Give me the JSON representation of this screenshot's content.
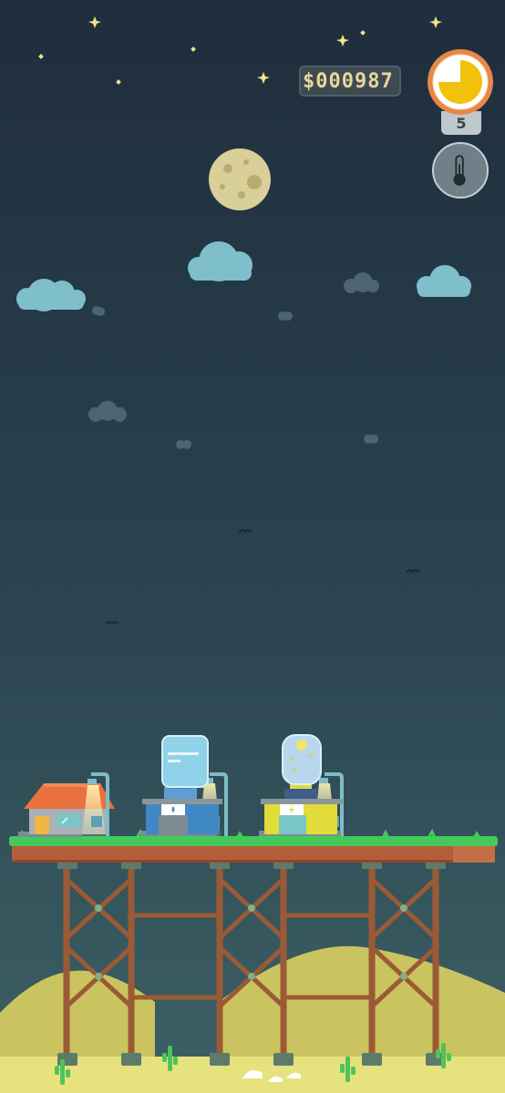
{
  "hud": {
    "money": "$000987",
    "level": "5",
    "time_dial_fill": 0.75,
    "thermometer_icon": "thermometer-icon"
  },
  "colors": {
    "sky_top": "#1f2d3c",
    "sky_bottom": "#37585e",
    "desert": "#e6e27e",
    "grass": "#45c95a",
    "deck": "#b35e3a",
    "trestle": "#9b5a35"
  },
  "buildings": [
    {
      "name": "house",
      "roof": "#e8713f"
    },
    {
      "name": "water-plant",
      "accent": "#3f88c5"
    },
    {
      "name": "power-plant",
      "accent": "#e2db39"
    }
  ]
}
